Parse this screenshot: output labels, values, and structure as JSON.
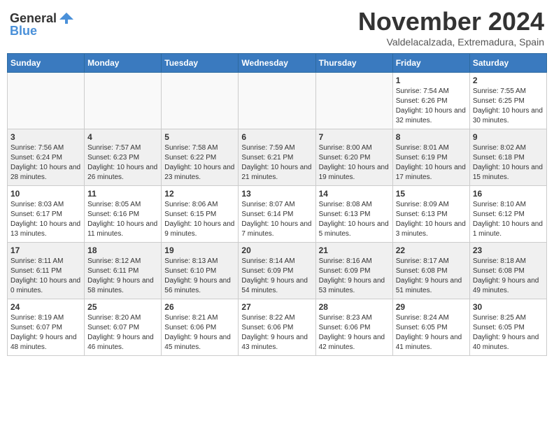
{
  "header": {
    "logo_general": "General",
    "logo_blue": "Blue",
    "month_title": "November 2024",
    "location": "Valdelacalzada, Extremadura, Spain"
  },
  "weekdays": [
    "Sunday",
    "Monday",
    "Tuesday",
    "Wednesday",
    "Thursday",
    "Friday",
    "Saturday"
  ],
  "weeks": [
    {
      "shaded": false,
      "days": [
        {
          "date": "",
          "info": ""
        },
        {
          "date": "",
          "info": ""
        },
        {
          "date": "",
          "info": ""
        },
        {
          "date": "",
          "info": ""
        },
        {
          "date": "",
          "info": ""
        },
        {
          "date": "1",
          "info": "Sunrise: 7:54 AM\nSunset: 6:26 PM\nDaylight: 10 hours and 32 minutes."
        },
        {
          "date": "2",
          "info": "Sunrise: 7:55 AM\nSunset: 6:25 PM\nDaylight: 10 hours and 30 minutes."
        }
      ]
    },
    {
      "shaded": true,
      "days": [
        {
          "date": "3",
          "info": "Sunrise: 7:56 AM\nSunset: 6:24 PM\nDaylight: 10 hours and 28 minutes."
        },
        {
          "date": "4",
          "info": "Sunrise: 7:57 AM\nSunset: 6:23 PM\nDaylight: 10 hours and 26 minutes."
        },
        {
          "date": "5",
          "info": "Sunrise: 7:58 AM\nSunset: 6:22 PM\nDaylight: 10 hours and 23 minutes."
        },
        {
          "date": "6",
          "info": "Sunrise: 7:59 AM\nSunset: 6:21 PM\nDaylight: 10 hours and 21 minutes."
        },
        {
          "date": "7",
          "info": "Sunrise: 8:00 AM\nSunset: 6:20 PM\nDaylight: 10 hours and 19 minutes."
        },
        {
          "date": "8",
          "info": "Sunrise: 8:01 AM\nSunset: 6:19 PM\nDaylight: 10 hours and 17 minutes."
        },
        {
          "date": "9",
          "info": "Sunrise: 8:02 AM\nSunset: 6:18 PM\nDaylight: 10 hours and 15 minutes."
        }
      ]
    },
    {
      "shaded": false,
      "days": [
        {
          "date": "10",
          "info": "Sunrise: 8:03 AM\nSunset: 6:17 PM\nDaylight: 10 hours and 13 minutes."
        },
        {
          "date": "11",
          "info": "Sunrise: 8:05 AM\nSunset: 6:16 PM\nDaylight: 10 hours and 11 minutes."
        },
        {
          "date": "12",
          "info": "Sunrise: 8:06 AM\nSunset: 6:15 PM\nDaylight: 10 hours and 9 minutes."
        },
        {
          "date": "13",
          "info": "Sunrise: 8:07 AM\nSunset: 6:14 PM\nDaylight: 10 hours and 7 minutes."
        },
        {
          "date": "14",
          "info": "Sunrise: 8:08 AM\nSunset: 6:13 PM\nDaylight: 10 hours and 5 minutes."
        },
        {
          "date": "15",
          "info": "Sunrise: 8:09 AM\nSunset: 6:13 PM\nDaylight: 10 hours and 3 minutes."
        },
        {
          "date": "16",
          "info": "Sunrise: 8:10 AM\nSunset: 6:12 PM\nDaylight: 10 hours and 1 minute."
        }
      ]
    },
    {
      "shaded": true,
      "days": [
        {
          "date": "17",
          "info": "Sunrise: 8:11 AM\nSunset: 6:11 PM\nDaylight: 10 hours and 0 minutes."
        },
        {
          "date": "18",
          "info": "Sunrise: 8:12 AM\nSunset: 6:11 PM\nDaylight: 9 hours and 58 minutes."
        },
        {
          "date": "19",
          "info": "Sunrise: 8:13 AM\nSunset: 6:10 PM\nDaylight: 9 hours and 56 minutes."
        },
        {
          "date": "20",
          "info": "Sunrise: 8:14 AM\nSunset: 6:09 PM\nDaylight: 9 hours and 54 minutes."
        },
        {
          "date": "21",
          "info": "Sunrise: 8:16 AM\nSunset: 6:09 PM\nDaylight: 9 hours and 53 minutes."
        },
        {
          "date": "22",
          "info": "Sunrise: 8:17 AM\nSunset: 6:08 PM\nDaylight: 9 hours and 51 minutes."
        },
        {
          "date": "23",
          "info": "Sunrise: 8:18 AM\nSunset: 6:08 PM\nDaylight: 9 hours and 49 minutes."
        }
      ]
    },
    {
      "shaded": false,
      "days": [
        {
          "date": "24",
          "info": "Sunrise: 8:19 AM\nSunset: 6:07 PM\nDaylight: 9 hours and 48 minutes."
        },
        {
          "date": "25",
          "info": "Sunrise: 8:20 AM\nSunset: 6:07 PM\nDaylight: 9 hours and 46 minutes."
        },
        {
          "date": "26",
          "info": "Sunrise: 8:21 AM\nSunset: 6:06 PM\nDaylight: 9 hours and 45 minutes."
        },
        {
          "date": "27",
          "info": "Sunrise: 8:22 AM\nSunset: 6:06 PM\nDaylight: 9 hours and 43 minutes."
        },
        {
          "date": "28",
          "info": "Sunrise: 8:23 AM\nSunset: 6:06 PM\nDaylight: 9 hours and 42 minutes."
        },
        {
          "date": "29",
          "info": "Sunrise: 8:24 AM\nSunset: 6:05 PM\nDaylight: 9 hours and 41 minutes."
        },
        {
          "date": "30",
          "info": "Sunrise: 8:25 AM\nSunset: 6:05 PM\nDaylight: 9 hours and 40 minutes."
        }
      ]
    }
  ]
}
